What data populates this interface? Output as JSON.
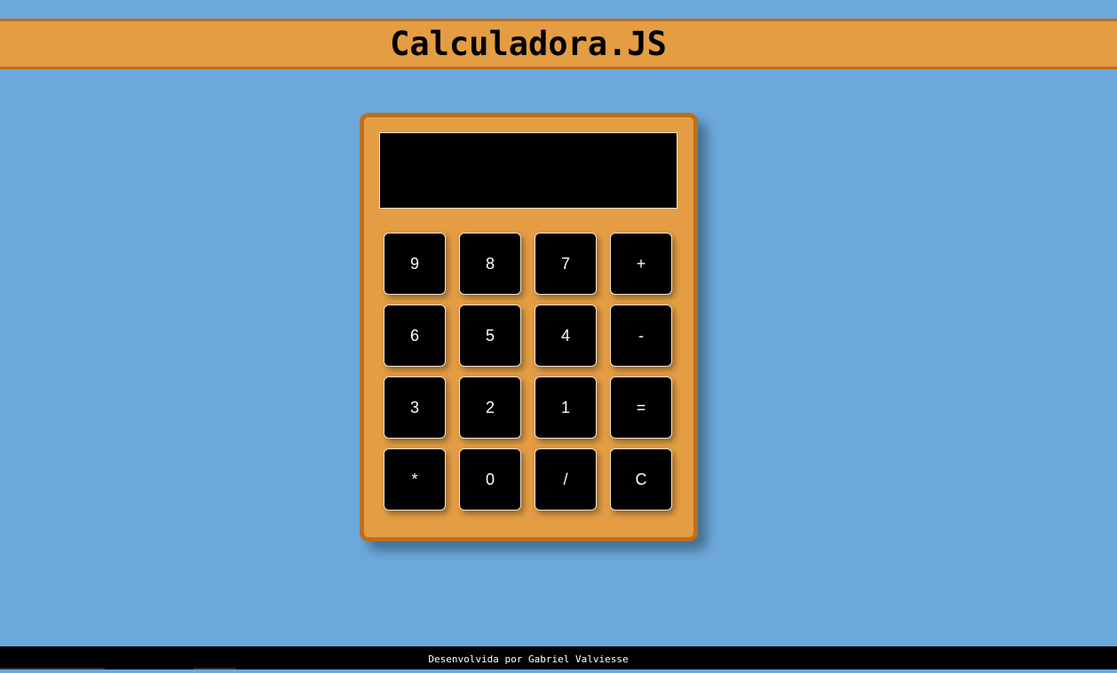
{
  "header": {
    "title": "Calculadora.JS"
  },
  "calculator": {
    "display_value": "",
    "keys": [
      {
        "label": "9",
        "name": "key-9"
      },
      {
        "label": "8",
        "name": "key-8"
      },
      {
        "label": "7",
        "name": "key-7"
      },
      {
        "label": "+",
        "name": "key-add"
      },
      {
        "label": "6",
        "name": "key-6"
      },
      {
        "label": "5",
        "name": "key-5"
      },
      {
        "label": "4",
        "name": "key-4"
      },
      {
        "label": "-",
        "name": "key-subtract"
      },
      {
        "label": "3",
        "name": "key-3"
      },
      {
        "label": "2",
        "name": "key-2"
      },
      {
        "label": "1",
        "name": "key-1"
      },
      {
        "label": "=",
        "name": "key-equals"
      },
      {
        "label": "*",
        "name": "key-multiply"
      },
      {
        "label": "0",
        "name": "key-0"
      },
      {
        "label": "/",
        "name": "key-divide"
      },
      {
        "label": "C",
        "name": "key-clear"
      }
    ]
  },
  "footer": {
    "credit": "Desenvolvida por Gabriel Valviesse"
  },
  "colors": {
    "background": "#6ca8dc",
    "accent": "#e49d43",
    "accent_border": "#bd6f1d",
    "key_background": "#000000",
    "key_text": "#ffffff"
  }
}
